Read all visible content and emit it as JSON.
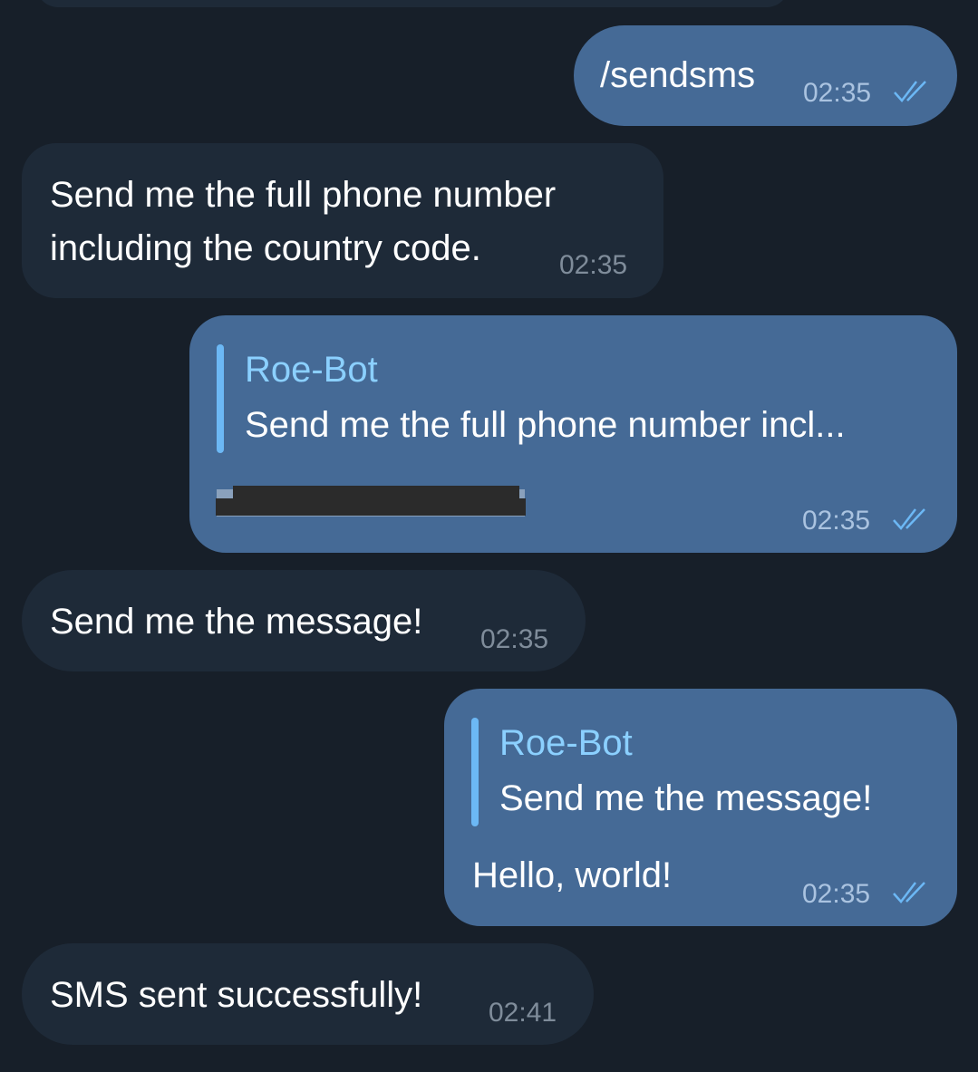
{
  "messages": [
    {
      "dir": "out",
      "text": "/sendsms",
      "time": "02:35",
      "status": "double-check-icon"
    },
    {
      "dir": "in",
      "lines": [
        "Send me the full phone number",
        "including the country code."
      ],
      "time": "02:35"
    },
    {
      "dir": "out",
      "reply": {
        "name": "Roe-Bot",
        "text": "Send me the full phone number incl..."
      },
      "text_redacted": true,
      "time": "02:35",
      "status": "double-check-icon"
    },
    {
      "dir": "in",
      "text": "Send me the message!",
      "time": "02:35"
    },
    {
      "dir": "out",
      "reply": {
        "name": "Roe-Bot",
        "text": "Send me the message!"
      },
      "text": "Hello, world!",
      "time": "02:35",
      "status": "double-check-icon"
    },
    {
      "dir": "in",
      "text": "SMS sent successfully!",
      "time": "02:41"
    }
  ],
  "colors": {
    "background": "#171f29",
    "incoming_bubble": "#1e2a38",
    "outgoing_bubble": "#456a96",
    "reply_accent": "#6cb8f5"
  }
}
